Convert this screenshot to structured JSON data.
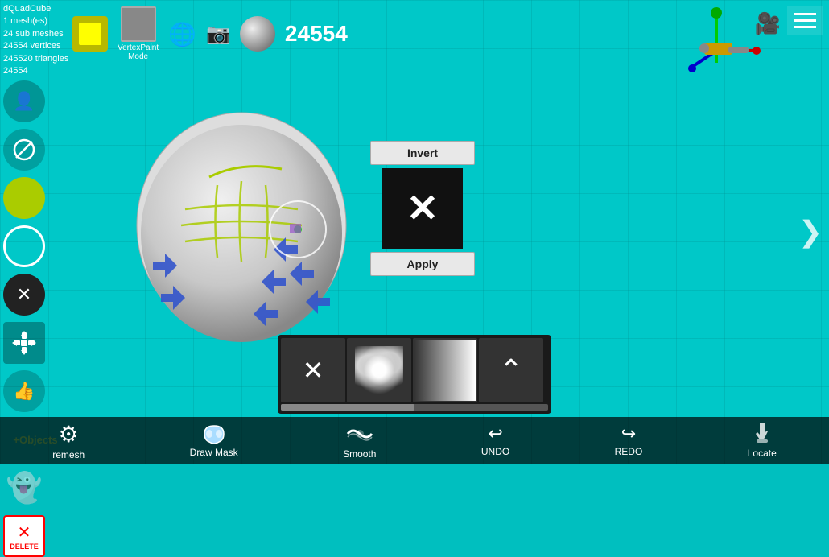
{
  "app": {
    "title": "dQuadCube",
    "mesh_count": "1 mesh(es)",
    "sub_meshes": "24 sub meshes",
    "vertices": "24554 vertices",
    "triangles": "245520 triangles",
    "vertex_id": "24554"
  },
  "header": {
    "vertex_count": "24554",
    "vertexpaint_label": "VertexPaint",
    "mode_label": "Mode"
  },
  "popup": {
    "invert_label": "Invert",
    "apply_label": "Apply"
  },
  "bottom_nav": {
    "remesh_label": "remesh",
    "draw_mask_label": "Draw Mask",
    "smooth_label": "Smooth",
    "undo_label": "UNDO",
    "redo_label": "REDO",
    "locate_label": "Locate"
  },
  "left_toolbar": {
    "objects_label": "+Objects",
    "delete_label": "DELETE"
  },
  "colors": {
    "bg": "#00c8c8",
    "accent": "#b8b800"
  }
}
